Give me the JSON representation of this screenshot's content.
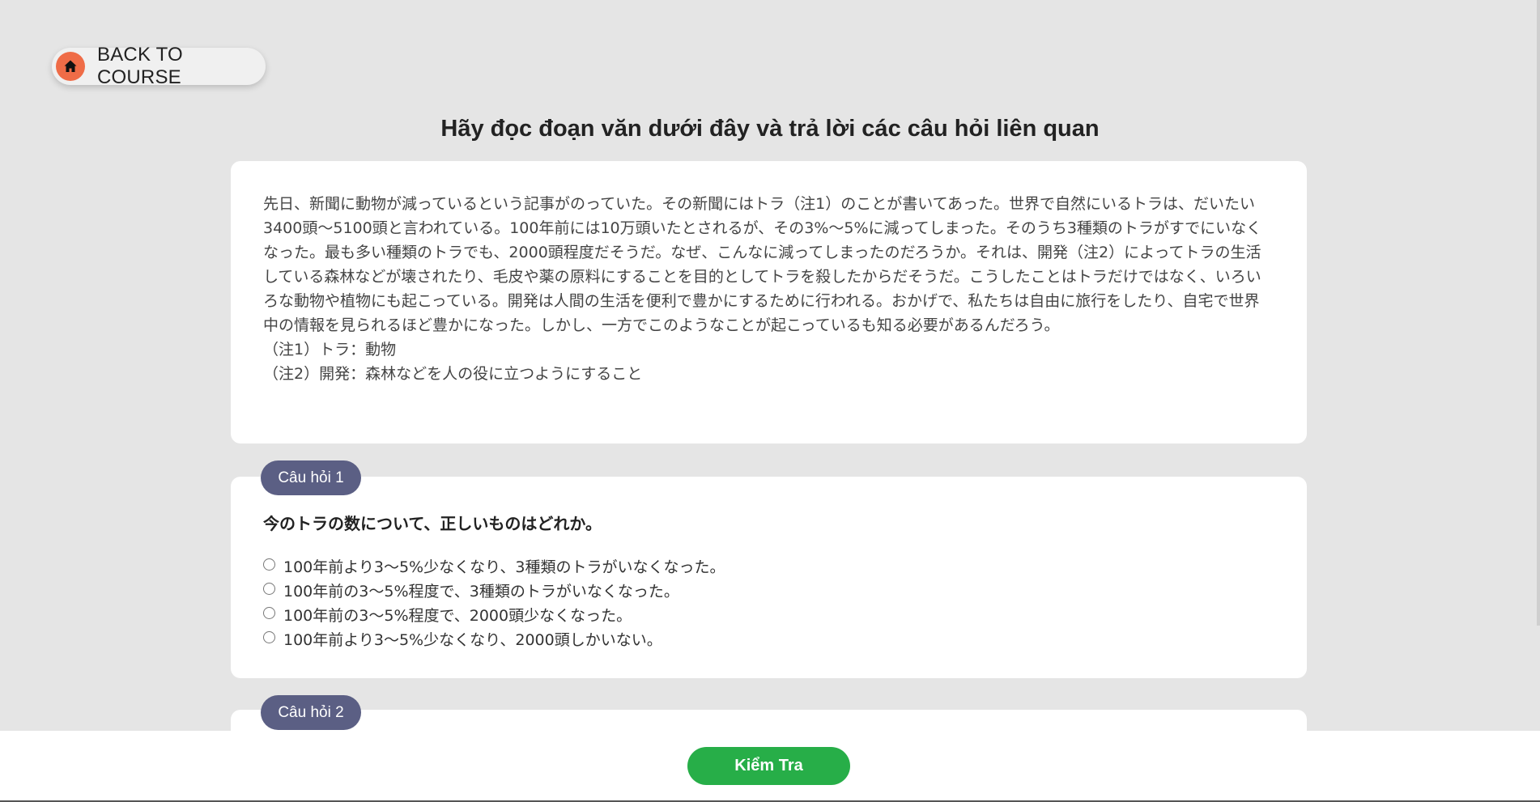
{
  "header": {
    "back_label": "BACK TO COURSE",
    "home_icon": "home-icon",
    "title": "Hãy đọc đoạn văn dưới đây và trả lời các câu hỏi liên quan"
  },
  "passage": {
    "text": "先日、新聞に動物が減っているという記事がのっていた。その新聞にはトラ（注1）のことが書いてあった。世界で自然にいるトラは、だいたい3400頭～5100頭と言われている。100年前には10万頭いたとされるが、その3%～5%に減ってしまった。そのうち3種類のトラがすでにいなくなった。最も多い種類のトラでも、2000頭程度だそうだ。なぜ、こんなに減ってしまったのだろうか。それは、開発（注2）によってトラの生活している森林などが壊されたり、毛皮や薬の原料にすることを目的としてトラを殺したからだそうだ。こうしたことはトラだけではなく、いろいろな動物や植物にも起こっている。開発は人間の生活を便利で豊かにするために行われる。おかげで、私たちは自由に旅行をしたり、自宅で世界中の情報を見られるほど豊かになった。しかし、一方でこのようなことが起こっているも知る必要があるんだろう。",
    "note1": "（注1）トラ：動物",
    "note2": "（注2）開発：森林などを人の役に立つようにすること"
  },
  "questions": [
    {
      "badge": "Câu hỏi 1",
      "text": "今のトラの数について、正しいものはどれか。",
      "options": [
        "100年前より3～5%少なくなり、3種類のトラがいなくなった。",
        "100年前の3～5%程度で、3種類のトラがいなくなった。",
        "100年前の3～5%程度で、2000頭少なくなった。",
        "100年前より3～5%少なくなり、2000頭しかいない。"
      ]
    },
    {
      "badge": "Câu hỏi 2"
    }
  ],
  "footer": {
    "check_label": "Kiểm Tra"
  },
  "colors": {
    "background": "#e5e5e5",
    "home_accent": "#ef6c47",
    "badge": "#5b5f84",
    "check_button": "#27ae48"
  }
}
